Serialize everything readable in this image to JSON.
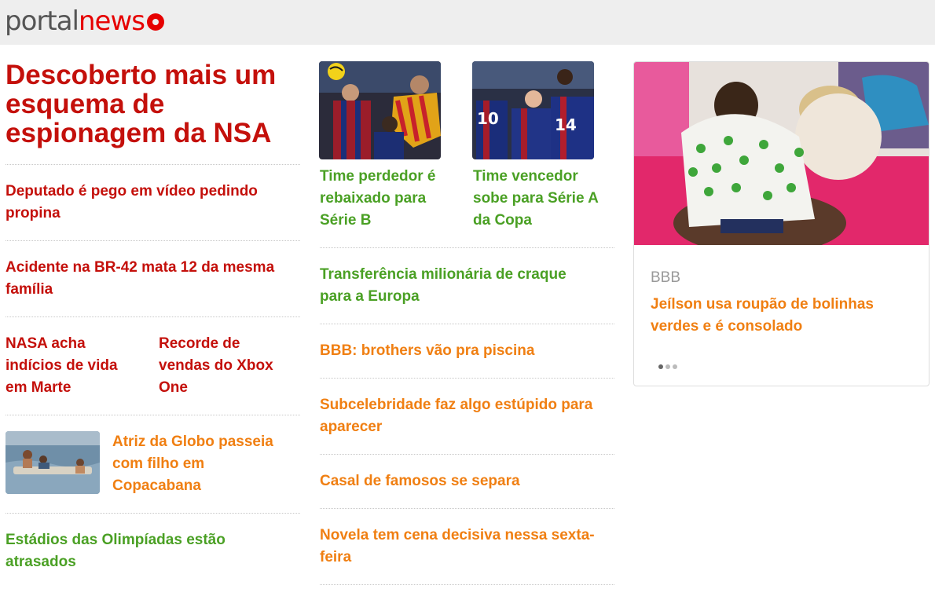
{
  "header": {
    "logo_portal": "portal",
    "logo_news": "news"
  },
  "col1": {
    "headline": "Descoberto mais um esquema de espionagem da NSA",
    "items": [
      "Deputado é pego em vídeo pedindo propina",
      "Acidente na BR-42 mata 12 da mesma família",
      "NASA acha indícios de vida em Marte",
      "Recorde de vendas do Xbox One",
      "Atriz da Globo passeia com filho em Copacabana",
      "Estádios das Olimpíadas estão atrasados"
    ]
  },
  "col2": {
    "sports": [
      "Time perdedor é rebaixado para Série B",
      "Time vencedor sobe para Série A da Copa"
    ],
    "items": [
      "Transferência milionária de craque para a Europa",
      "BBB: brothers vão pra piscina",
      "Subcelebridade faz algo estúpido para aparecer",
      "Casal de famosos se separa",
      "Novela tem cena decisiva nessa sexta-feira"
    ]
  },
  "card": {
    "category": "BBB",
    "title": "Jeílson usa roupão de bolinhas verdes e é consolado",
    "slides_total": 3,
    "slides_active": 1
  },
  "colors": {
    "red": "#c4100b",
    "green": "#4aa024",
    "orange": "#f07f12",
    "header_bg": "#eeeeee"
  }
}
